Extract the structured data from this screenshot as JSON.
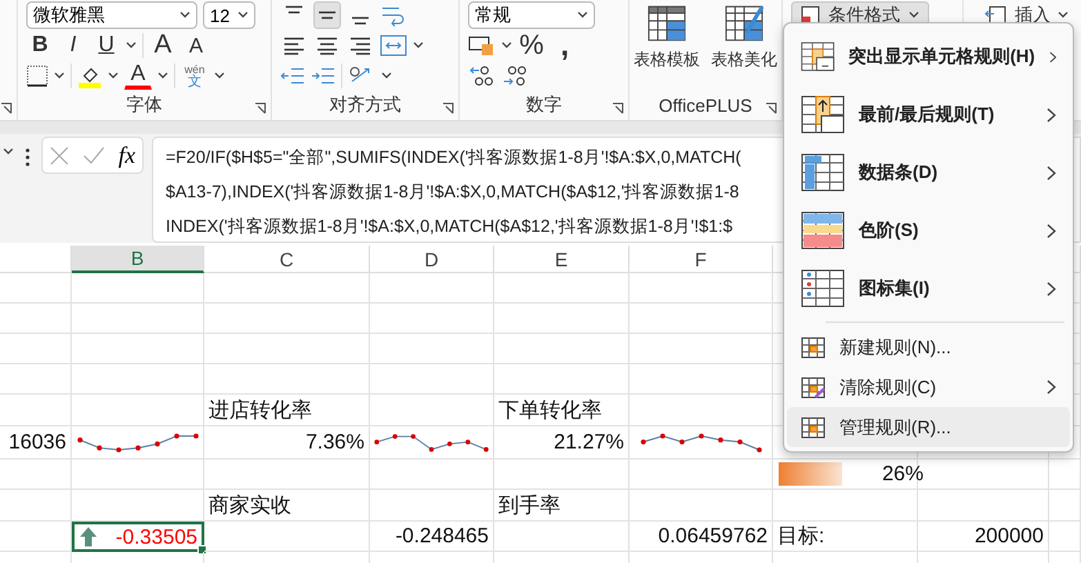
{
  "ribbon": {
    "font_name": "微软雅黑",
    "font_size": "12",
    "style_buttons": [
      "B",
      "I",
      "U"
    ],
    "grow_font": "A",
    "shrink_font": "A",
    "font_color": "A",
    "phonetic_top": "wén",
    "phonetic_bottom": "文",
    "alignment_buttons": [
      {
        "selected": false
      },
      {
        "selected": true
      },
      {
        "selected": false
      }
    ],
    "number_format": "常规",
    "percent": "%",
    "comma": ",",
    "officeplus_buttons": [
      "表格模板",
      "表格美化"
    ],
    "conditional_format": "条件格式",
    "insert": "插入",
    "group_labels": [
      "字体",
      "对齐方式",
      "数字",
      "OfficePLUS"
    ]
  },
  "formula_bar": {
    "function_label": "fx",
    "lines": [
      "=F20/IF($H$5=\"全部\",SUMIFS(INDEX('抖客源数据1-8月'!$A:$X,0,MATCH(",
      "$A13-7),INDEX('抖客源数据1-8月'!$A:$X,0,MATCH($A$12,'抖客源数据1-8",
      "INDEX('抖客源数据1-8月'!$A:$X,0,MATCH($A$12,'抖客源数据1-8月'!$1:$"
    ]
  },
  "columns": [
    {
      "label": "B",
      "selected": true
    },
    {
      "label": "C",
      "selected": false
    },
    {
      "label": "D",
      "selected": false
    },
    {
      "label": "E",
      "selected": false
    },
    {
      "label": "F",
      "selected": false
    }
  ],
  "rows": [
    {
      "kind": "empty"
    },
    {
      "kind": "empty"
    },
    {
      "kind": "empty"
    },
    {
      "kind": "empty"
    },
    {
      "kind": "cells",
      "cells": [
        {
          "kind": "blank"
        },
        {
          "kind": "blank"
        },
        {
          "kind": "label",
          "text": "进店转化率",
          "selected": false
        },
        {
          "kind": "blank"
        },
        {
          "kind": "label",
          "text": "下单转化率",
          "selected": false
        },
        {
          "kind": "blank"
        },
        {
          "kind": "blank"
        },
        {
          "kind": "blank"
        },
        {
          "kind": "blank"
        }
      ]
    },
    {
      "kind": "cells",
      "cells": [
        {
          "kind": "number",
          "text": "16036",
          "selected": false
        },
        {
          "kind": "sparkline"
        },
        {
          "kind": "number",
          "text": "7.36%",
          "selected": false
        },
        {
          "kind": "sparkline"
        },
        {
          "kind": "number",
          "text": "21.27%",
          "selected": false
        },
        {
          "kind": "sparkline"
        },
        {
          "kind": "blank"
        },
        {
          "kind": "blank"
        },
        {
          "kind": "blank"
        }
      ]
    },
    {
      "kind": "cells",
      "cells": [
        {
          "kind": "blank"
        },
        {
          "kind": "blank"
        },
        {
          "kind": "blank"
        },
        {
          "kind": "blank"
        },
        {
          "kind": "blank"
        },
        {
          "kind": "blank"
        },
        {
          "kind": "databar",
          "text": "26%",
          "level": 0.47
        },
        {
          "kind": "blank"
        },
        {
          "kind": "blank"
        }
      ]
    },
    {
      "kind": "cells",
      "cells": [
        {
          "kind": "blank"
        },
        {
          "kind": "blank"
        },
        {
          "kind": "label",
          "text": "商家实收",
          "selected": false
        },
        {
          "kind": "blank"
        },
        {
          "kind": "label",
          "text": "到手率",
          "selected": false
        },
        {
          "kind": "blank"
        },
        {
          "kind": "blank"
        },
        {
          "kind": "blank"
        },
        {
          "kind": "blank"
        }
      ]
    },
    {
      "kind": "cells",
      "cells": [
        {
          "kind": "blank"
        },
        {
          "kind": "icon_value",
          "text": "-0.33505",
          "color": "#ff0000",
          "selected": true
        },
        {
          "kind": "blank"
        },
        {
          "kind": "number",
          "text": "-0.248465",
          "selected": false
        },
        {
          "kind": "blank"
        },
        {
          "kind": "number",
          "text": "0.06459762",
          "selected": false
        },
        {
          "kind": "label",
          "text": "目标:",
          "selected": false
        },
        {
          "kind": "number",
          "text": "200000",
          "selected": false
        },
        {
          "kind": "blank"
        }
      ]
    },
    {
      "kind": "empty"
    }
  ],
  "menu": {
    "items": [
      {
        "kind": "large",
        "label": "突出显示单元格规则(H)",
        "submenu": true,
        "selected": false
      },
      {
        "kind": "large",
        "label": "最前/最后规则(T)",
        "submenu": true,
        "selected": false
      },
      {
        "kind": "large",
        "label": "数据条(D)",
        "submenu": true,
        "selected": false
      },
      {
        "kind": "large",
        "label": "色阶(S)",
        "submenu": true,
        "selected": false
      },
      {
        "kind": "large",
        "label": "图标集(I)",
        "submenu": true,
        "selected": false
      },
      {
        "kind": "small",
        "label": "新建规则(N)...",
        "submenu": false,
        "selected": false
      },
      {
        "kind": "small",
        "label": "清除规则(C)",
        "submenu": true,
        "selected": false
      },
      {
        "kind": "small",
        "label": "管理规则(R)...",
        "submenu": false,
        "selected": true
      }
    ]
  }
}
